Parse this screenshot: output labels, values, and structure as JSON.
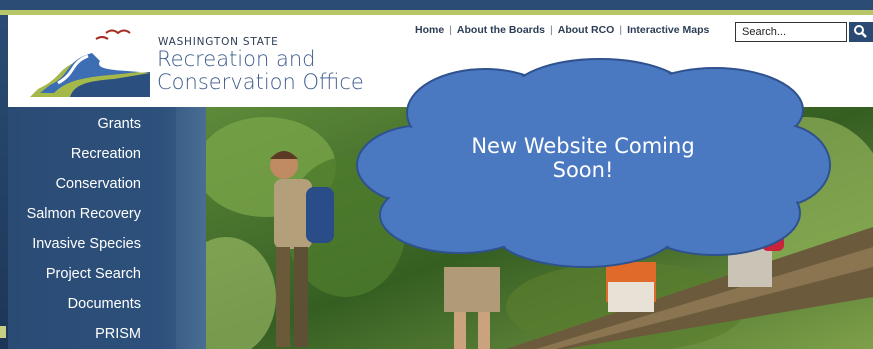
{
  "header": {
    "logo_top": "WASHINGTON STATE",
    "logo_line1": "Recreation and",
    "logo_line2": "Conservation Office"
  },
  "topnav": {
    "items": [
      "Home",
      "About the Boards",
      "About RCO",
      "Interactive Maps"
    ]
  },
  "search": {
    "value": "Search...",
    "icon": "search-icon"
  },
  "sidebar": {
    "items": [
      {
        "label": "Grants"
      },
      {
        "label": "Recreation"
      },
      {
        "label": "Conservation"
      },
      {
        "label": "Salmon Recovery"
      },
      {
        "label": "Invasive Species"
      },
      {
        "label": "Project Search"
      },
      {
        "label": "Documents"
      },
      {
        "label": "PRISM"
      }
    ]
  },
  "callout": {
    "line1": "New Website Coming",
    "line2": "Soon!"
  },
  "colors": {
    "nav_bg": "#2d517c",
    "accent": "#b8c66a",
    "cloud": "#4a79c2",
    "cloud_border": "#2f528f"
  }
}
